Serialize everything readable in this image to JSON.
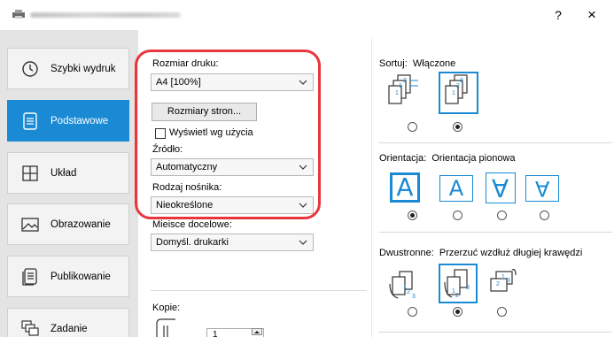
{
  "window": {
    "help_label": "?",
    "close_label": "×"
  },
  "nav": {
    "items": [
      {
        "label": "Szybki wydruk",
        "icon": "clock-icon"
      },
      {
        "label": "Podstawowe",
        "icon": "document-icon"
      },
      {
        "label": "Układ",
        "icon": "grid-icon"
      },
      {
        "label": "Obrazowanie",
        "icon": "image-icon"
      },
      {
        "label": "Publikowanie",
        "icon": "booklet-icon"
      },
      {
        "label": "Zadanie",
        "icon": "jobs-icon"
      }
    ],
    "active_index": 1
  },
  "basic": {
    "print_size_label": "Rozmiar druku:",
    "print_size_value": "A4  [100%]",
    "page_sizes_button": "Rozmiary stron...",
    "show_by_usage_label": "Wyświetl wg użycia",
    "source_label": "Źródło:",
    "source_value": "Automatyczny",
    "media_type_label": "Rodzaj nośnika:",
    "media_type_value": "Nieokreślone",
    "destination_label": "Miejsce docelowe:",
    "destination_value": "Domyśl. drukarki",
    "copies_label": "Kopie:",
    "copies_value": "1"
  },
  "collate": {
    "label": "Sortuj:",
    "value": "Włączone",
    "selected_index": 1
  },
  "orientation": {
    "label": "Orientacja:",
    "value": "Orientacja pionowa",
    "selected_index": 0,
    "glyph": "A"
  },
  "duplex": {
    "label": "Dwustronne:",
    "value": "Przerzuć wzdłuż długiej krawędzi",
    "selected_index": 1
  },
  "colors": {
    "accent": "#1a8ad4",
    "highlight": "#e8363c",
    "nav_bg": "#e4e4e4"
  }
}
